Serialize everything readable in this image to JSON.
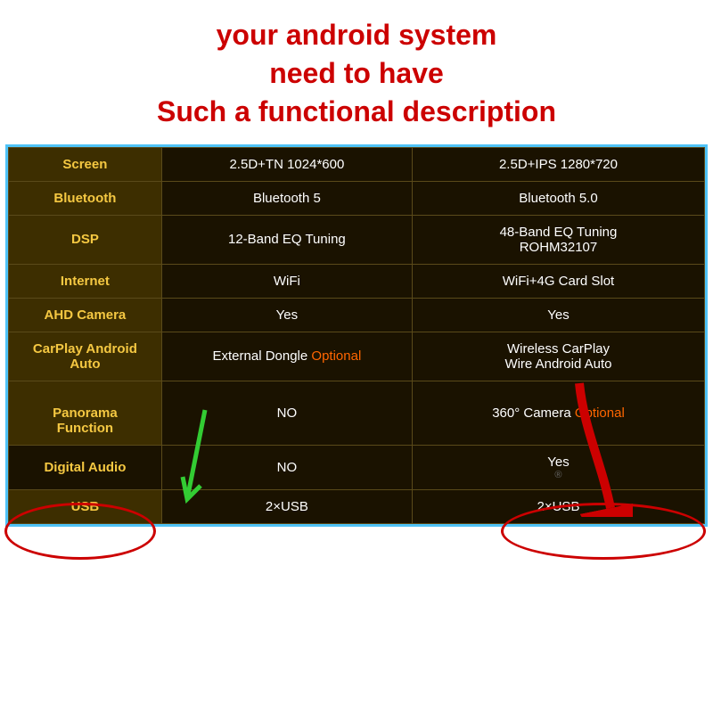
{
  "header": {
    "line1": "your android system",
    "line2": "need to have",
    "line3": "Such a functional description"
  },
  "table": {
    "rows": [
      {
        "label": "Screen",
        "col1": "2.5D+TN 1024*600",
        "col2": "2.5D+IPS 1280*720"
      },
      {
        "label": "Bluetooth",
        "col1": "Bluetooth 5",
        "col2": "Bluetooth 5.0"
      },
      {
        "label": "DSP",
        "col1": "12-Band EQ Tuning",
        "col2": "48-Band EQ Tuning\nROHM32107"
      },
      {
        "label": "Internet",
        "col1": "WiFi",
        "col2": "WiFi+4G Card Slot"
      },
      {
        "label": "AHD Camera",
        "col1": "Yes",
        "col2": "Yes"
      },
      {
        "label": "CarPlay\nAndroid Auto",
        "col1_main": "External Dongle ",
        "col1_optional": "Optional",
        "col2_main": "Wireless CarPlay\nWire Android Auto",
        "col2_optional": ""
      },
      {
        "label": "Panorama\nFunction",
        "col1": "NO",
        "col2_main": "360° Camera ",
        "col2_optional": "Optional",
        "isHighlight": true
      },
      {
        "label": "Digital Audio",
        "col1": "NO",
        "col2": "Yes"
      },
      {
        "label": "USB",
        "col1": "2×USB",
        "col2": "2×USB"
      }
    ]
  }
}
